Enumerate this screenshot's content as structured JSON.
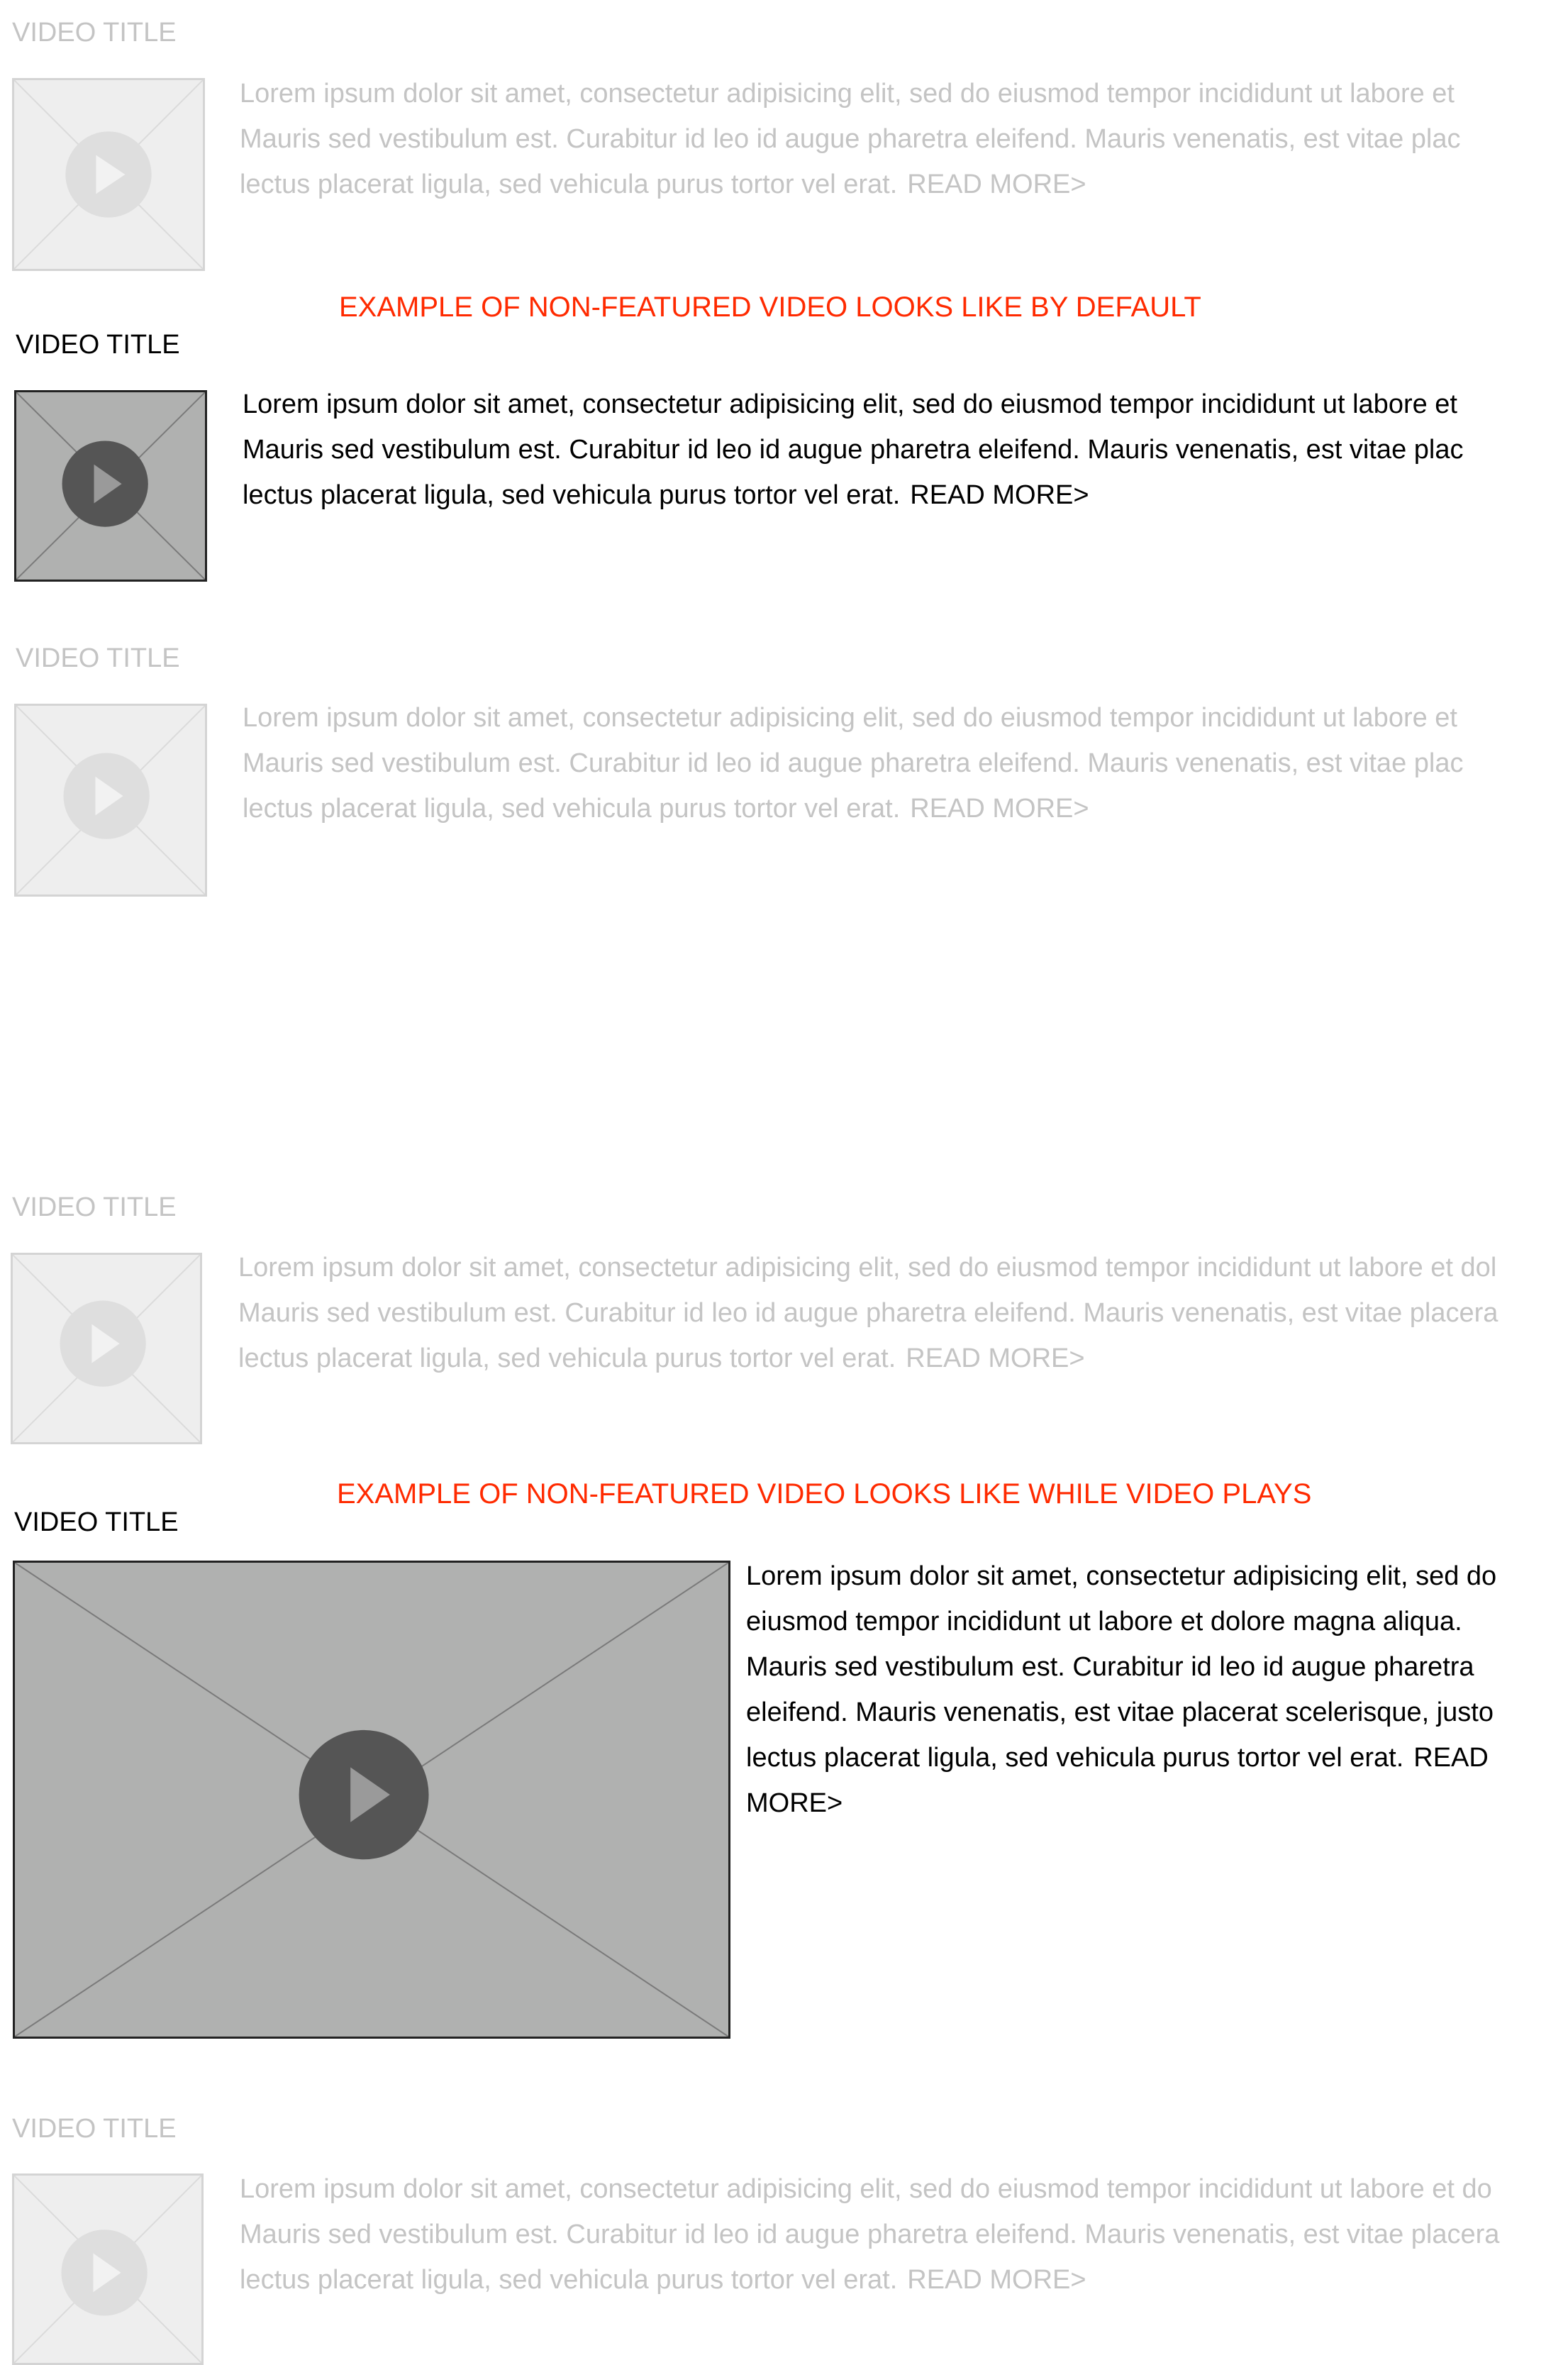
{
  "colors": {
    "annotation": "#ff2a00",
    "faded_text": "#c4c4c4",
    "active_text": "#000000",
    "inactive_thumb_bg": "#eeeeee",
    "inactive_thumb_play": "#dedede",
    "active_thumb_bg": "#b0b1b0",
    "active_thumb_play": "#555555"
  },
  "annotations": {
    "default": "EXAMPLE OF NON-FEATURED VIDEO LOOKS LIKE BY DEFAULT",
    "playing": "EXAMPLE OF NON-FEATURED VIDEO LOOKS LIKE WHILE VIDEO PLAYS"
  },
  "videos": [
    {
      "title": "VIDEO TITLE",
      "state": "inactive",
      "thumbnail_icon": "play-icon",
      "lines": [
        "Lorem ipsum dolor sit amet, consectetur adipisicing elit, sed do eiusmod tempor incididunt ut labore et",
        "Mauris sed vestibulum est. Curabitur id leo id augue pharetra eleifend. Mauris venenatis, est vitae plac",
        "lectus placerat ligula, sed vehicula purus tortor vel erat."
      ],
      "read_more": "READ MORE>"
    },
    {
      "title": "VIDEO TITLE",
      "state": "active",
      "thumbnail_icon": "play-icon",
      "lines": [
        "Lorem ipsum dolor sit amet, consectetur adipisicing elit, sed do eiusmod tempor incididunt ut labore et",
        "Mauris sed vestibulum est. Curabitur id leo id augue pharetra eleifend. Mauris venenatis, est vitae plac",
        "lectus placerat ligula, sed vehicula purus tortor vel erat."
      ],
      "read_more": "READ MORE>"
    },
    {
      "title": "VIDEO TITLE",
      "state": "inactive",
      "thumbnail_icon": "play-icon",
      "lines": [
        "Lorem ipsum dolor sit amet, consectetur adipisicing elit, sed do eiusmod tempor incididunt ut labore et",
        "Mauris sed vestibulum est. Curabitur id leo id augue pharetra eleifend. Mauris venenatis, est vitae plac",
        "lectus placerat ligula, sed vehicula purus tortor vel erat."
      ],
      "read_more": "READ MORE>"
    },
    {
      "title": "VIDEO TITLE",
      "state": "inactive",
      "thumbnail_icon": "play-icon",
      "lines": [
        "Lorem ipsum dolor sit amet, consectetur adipisicing elit, sed do eiusmod tempor incididunt ut labore et dol",
        "Mauris sed vestibulum est. Curabitur id leo id augue pharetra eleifend. Mauris venenatis, est vitae placera",
        "lectus placerat ligula, sed vehicula purus tortor vel erat."
      ],
      "read_more": "READ MORE>"
    },
    {
      "title": "VIDEO TITLE",
      "state": "playing",
      "thumbnail_icon": "play-icon",
      "text": "Lorem ipsum dolor sit amet, consectetur adipisicing elit, sed do eiusmod tempor incididunt ut labore et dolore magna aliqua.  Mauris sed vestibulum est. Curabitur id leo id augue pharetra eleifend. Mauris venenatis, est vitae placerat scelerisque, justo lectus placerat ligula, sed vehicula purus tortor vel erat.",
      "read_more": "READ MORE>"
    },
    {
      "title": "VIDEO TITLE",
      "state": "inactive",
      "thumbnail_icon": "play-icon",
      "lines": [
        "Lorem ipsum dolor sit amet, consectetur adipisicing elit, sed do eiusmod tempor incididunt ut labore et do",
        "Mauris sed vestibulum est. Curabitur id leo id augue pharetra eleifend. Mauris venenatis, est vitae placera",
        "lectus placerat ligula, sed vehicula purus tortor vel erat."
      ],
      "read_more": "READ MORE>"
    }
  ]
}
